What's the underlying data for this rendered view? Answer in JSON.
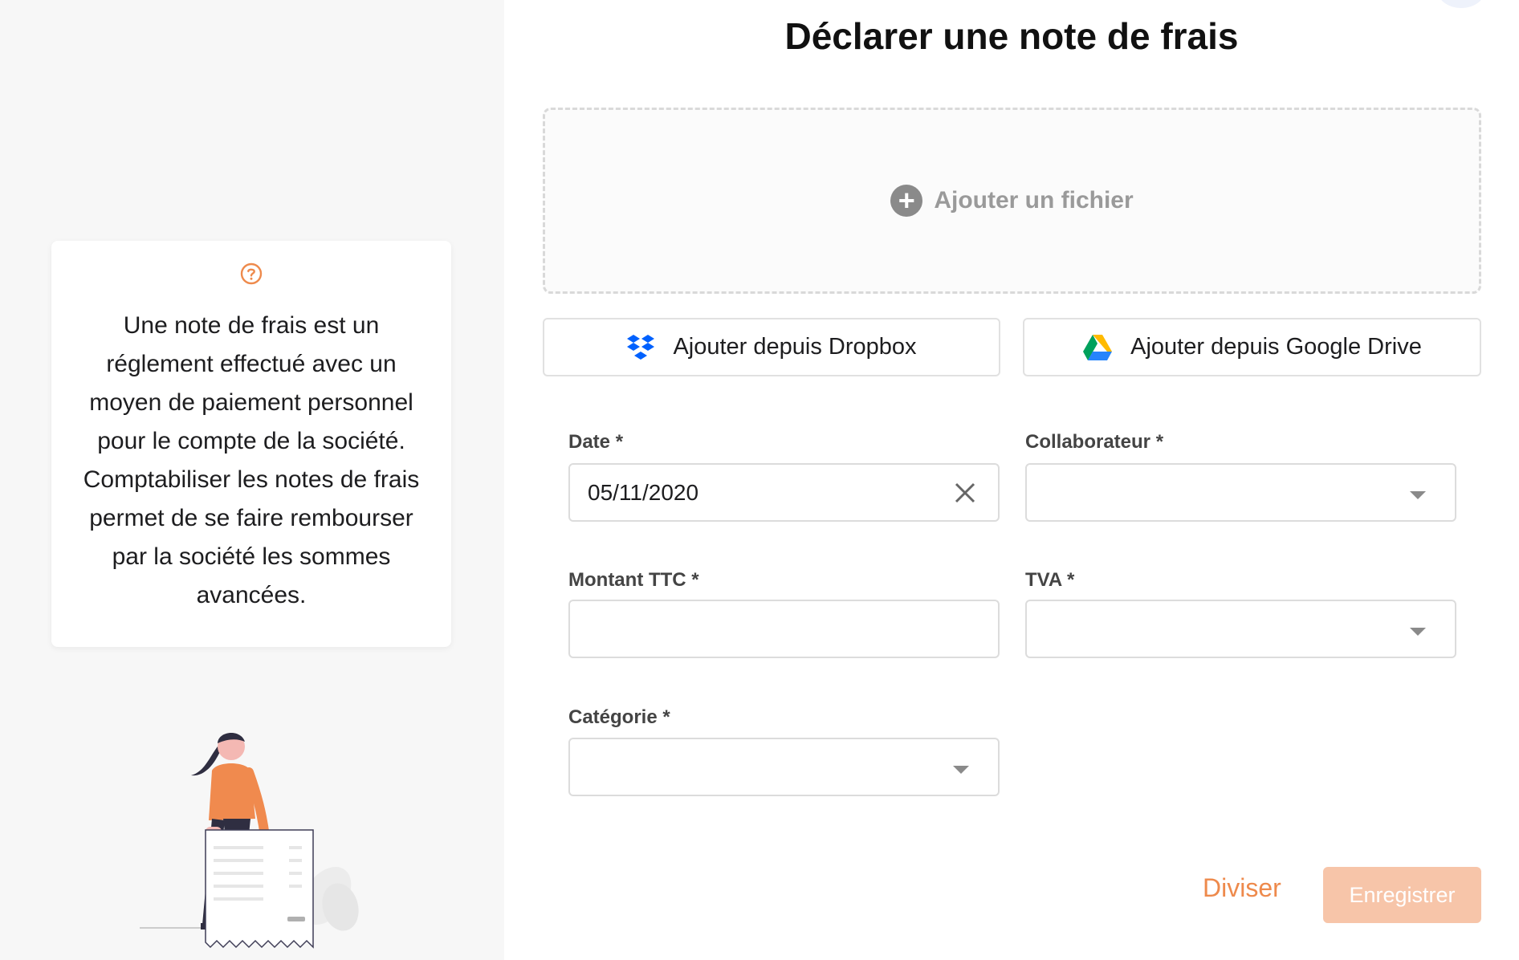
{
  "help": {
    "text": "Une note de frais est un réglement effectué avec un moyen de paiement personnel pour le compte de la société. Comptabiliser les notes de frais permet de se faire rembourser par la société les sommes avancées."
  },
  "page": {
    "title": "Déclarer une note de frais"
  },
  "upload": {
    "add_file_label": "Ajouter un fichier",
    "dropbox_label": "Ajouter depuis Dropbox",
    "gdrive_label": "Ajouter depuis Google Drive"
  },
  "form": {
    "date": {
      "label": "Date *",
      "value": "05/11/2020"
    },
    "collaborateur": {
      "label": "Collaborateur *",
      "value": ""
    },
    "montant": {
      "label": "Montant TTC *",
      "value": ""
    },
    "tva": {
      "label": "TVA *",
      "value": ""
    },
    "categorie": {
      "label": "Catégorie *",
      "value": ""
    }
  },
  "actions": {
    "split_label": "Diviser",
    "save_label": "Enregistrer"
  },
  "colors": {
    "accent": "#ee8a4c",
    "save_disabled": "#f7c5a9",
    "sidebar_bg": "#f7f7f7"
  },
  "icons": [
    "help-icon",
    "plus-circle-icon",
    "dropbox-icon",
    "google-drive-icon",
    "clear-icon",
    "chevron-down-icon"
  ]
}
